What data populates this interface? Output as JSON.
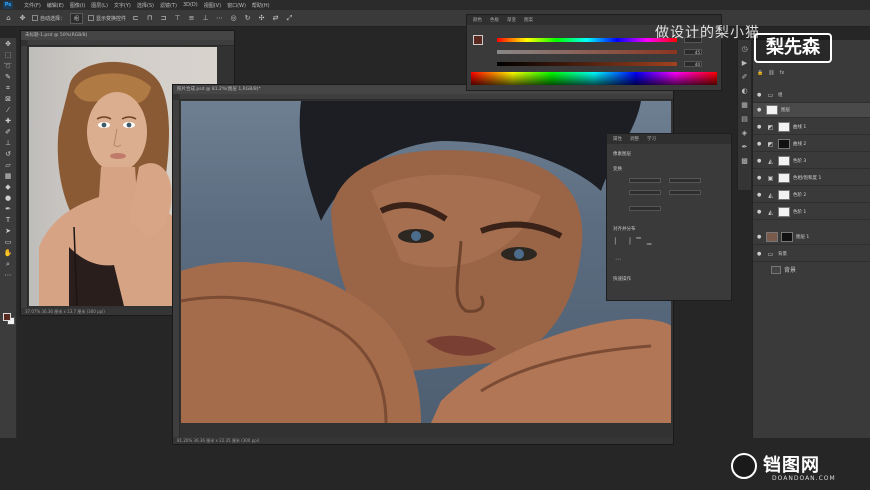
{
  "menubar": {
    "items": [
      "文件(F)",
      "编辑(E)",
      "图像(I)",
      "图层(L)",
      "文字(Y)",
      "选择(S)",
      "滤镜(T)",
      "3D(D)",
      "视图(V)",
      "窗口(W)",
      "帮助(H)"
    ]
  },
  "options": {
    "auto_select": "自动选择：",
    "group": "组",
    "show_transform": "显示变换控件"
  },
  "doc1": {
    "title": "未标题-1.psd @ 50%(RGB/8)",
    "footer": "37.07%   36.36 厘米 x 13.7 厘米 (300 ppi)"
  },
  "doc2": {
    "title": "照片合成.psd @ 81.2%(图层 1,RGB/8)*",
    "footer": "81.20%   36.36 厘米 x 22.35 厘米 (300 ppi)"
  },
  "color_panel": {
    "tabs": [
      "颜色",
      "色板",
      "渐变",
      "图案"
    ],
    "values": [
      "",
      "45",
      "40"
    ]
  },
  "properties_panel": {
    "tabs": [
      "属性",
      "调整",
      "学习"
    ],
    "header": "像素图层",
    "sec_transform": "变换",
    "sec_align": "对齐并分布",
    "sec_quick": "快速操作"
  },
  "layers": {
    "items": [
      {
        "name": "组",
        "kind": "folder"
      },
      {
        "name": "图层",
        "kind": "pixel",
        "selected": true
      },
      {
        "name": "曲线 1",
        "kind": "adj"
      },
      {
        "name": "曲线 2",
        "kind": "adj"
      },
      {
        "name": "色阶 3",
        "kind": "adj"
      },
      {
        "name": "色相/饱和度 1",
        "kind": "adj"
      },
      {
        "name": "色阶 2",
        "kind": "adj"
      },
      {
        "name": "色阶 1",
        "kind": "adj"
      },
      {
        "name": "图层 1",
        "kind": "pixel"
      },
      {
        "name": "背景",
        "kind": "folder"
      }
    ]
  },
  "watermark": {
    "top_text": "做设计的梨小猫",
    "badge": "梨先森",
    "bottom_logo": "铛图网",
    "bottom_sub": "DOANDOAN.COM"
  },
  "colors": {
    "accent": "#31a8ff",
    "panel": "#3a3a3a",
    "bg": "#262626"
  }
}
